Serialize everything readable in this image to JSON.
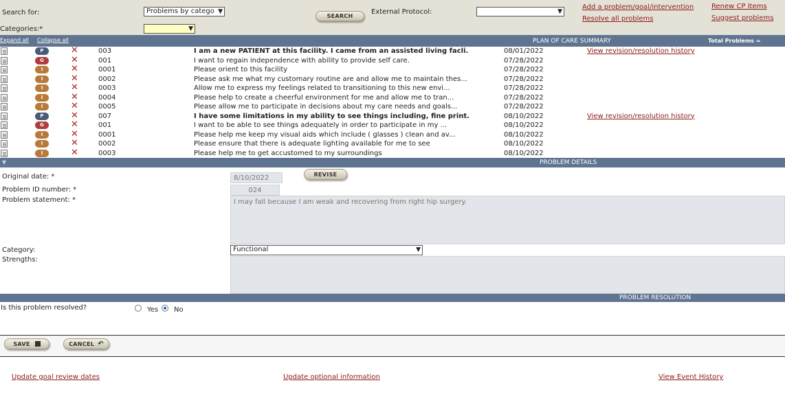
{
  "toolbar": {
    "search_for_label": "Search for:",
    "search_for_value": "Problems by catego",
    "search_button": "SEARCH",
    "external_protocol_label": "External Protocol:",
    "external_protocol_value": "",
    "categories_label": "Categories:*",
    "categories_value": "",
    "add_link": "Add a problem/goal/intervention",
    "resolve_link": "Resolve all problems",
    "renew_link": "Renew CP Items",
    "suggest_link": "Suggest problems"
  },
  "summary": {
    "expand_all": "Expand all",
    "collapse_all": "Collapse all",
    "title": "PLAN OF CARE SUMMARY",
    "total_label": "Total Problems ="
  },
  "rows": [
    {
      "type": "P",
      "num": "003",
      "text": "I am a new PATIENT at this facility. I came from an assisted living facli...",
      "date": "08/01/2022",
      "history": "View revision/resolution history",
      "bold": true
    },
    {
      "type": "G",
      "num": "001",
      "text": "I want to regain independence with ability to provide self care.",
      "date": "07/28/2022",
      "history": "",
      "bold": false
    },
    {
      "type": "I",
      "num": "0001",
      "text": "Please orient to this facility",
      "date": "07/28/2022",
      "history": "",
      "bold": false
    },
    {
      "type": "I",
      "num": "0002",
      "text": "Please ask me what my customary routine are and allow me to maintain thes...",
      "date": "07/28/2022",
      "history": "",
      "bold": false
    },
    {
      "type": "I",
      "num": "0003",
      "text": "Allow me to express my feelings related to transitioning to this new envi...",
      "date": "07/28/2022",
      "history": "",
      "bold": false
    },
    {
      "type": "I",
      "num": "0004",
      "text": "Please help to create a cheerful environment for me and allow me to tran...",
      "date": "07/28/2022",
      "history": "",
      "bold": false
    },
    {
      "type": "I",
      "num": "0005",
      "text": "Please allow me to participate in decisions about my care needs and goals...",
      "date": "07/28/2022",
      "history": "",
      "bold": false
    },
    {
      "type": "P",
      "num": "007",
      "text": "I have some limitations in my ability to see things including, fine print...",
      "date": "08/10/2022",
      "history": "View revision/resolution history",
      "bold": true
    },
    {
      "type": "G",
      "num": "001",
      "text": "I want to be able to see things adequately in order to participate in my ...",
      "date": "08/10/2022",
      "history": "",
      "bold": false
    },
    {
      "type": "I",
      "num": "0001",
      "text": "Please help me keep my visual aids which include ( glasses ) clean and av...",
      "date": "08/10/2022",
      "history": "",
      "bold": false
    },
    {
      "type": "I",
      "num": "0002",
      "text": "Please ensure that there is adequate lighting available for me to see",
      "date": "08/10/2022",
      "history": "",
      "bold": false
    },
    {
      "type": "I",
      "num": "0003",
      "text": "Please help me to get accustomed to my surroundings",
      "date": "08/10/2022",
      "history": "",
      "bold": false
    }
  ],
  "details": {
    "title": "PROBLEM DETAILS",
    "original_date_label": "Original date: *",
    "original_date_value": "8/10/2022",
    "revise_button": "REVISE",
    "problem_id_label": "Problem ID number: *",
    "problem_id_value": "024",
    "statement_label": "Problem statement: *",
    "statement_value": "I may fall because I am weak and recovering from right hip surgery.",
    "category_label": "Category:",
    "category_value": "Functional",
    "strengths_label": "Strengths:",
    "strengths_value": ""
  },
  "resolution": {
    "title": "PROBLEM RESOLUTION",
    "question": "Is this problem resolved?",
    "yes_label": "Yes",
    "no_label": "No",
    "selected": "No"
  },
  "actions": {
    "save": "SAVE",
    "cancel": "CANCEL"
  },
  "footer": {
    "goal_review": "Update goal review dates",
    "optional_info": "Update optional information",
    "event_history": "View Event History"
  }
}
